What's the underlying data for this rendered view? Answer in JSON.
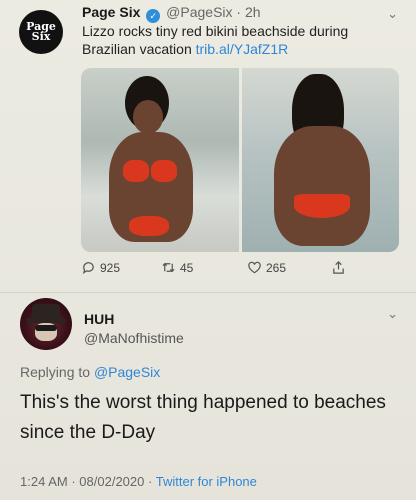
{
  "quoted_tweet": {
    "avatar_text": [
      "Page",
      "Six"
    ],
    "display_name": "Page Six",
    "handle": "@PageSix",
    "separator": "·",
    "time": "2h",
    "text": "Lizzo rocks tiny red bikini beachside during Brazilian vacation",
    "link": "trib.al/YJafZ1R",
    "replies": "925",
    "retweets": "45",
    "likes": "265"
  },
  "tweet": {
    "display_name": "HUH",
    "handle": "@MaNofhistime",
    "replying_prefix": "Replying to",
    "replying_mention": "@PageSix",
    "text": "This's the worst thing happened to beaches since the D-Day",
    "time": "1:24 AM",
    "date": "08/02/2020",
    "separator": "·",
    "client": "Twitter for iPhone"
  },
  "colors": {
    "background": "#e9e7dd",
    "link": "#2f86d6",
    "verified": "#2f8fd8",
    "bikini": "#d9381e"
  },
  "icons": [
    "verified-badge-icon",
    "chevron-down-icon",
    "reply-icon",
    "retweet-icon",
    "like-icon",
    "share-icon"
  ]
}
